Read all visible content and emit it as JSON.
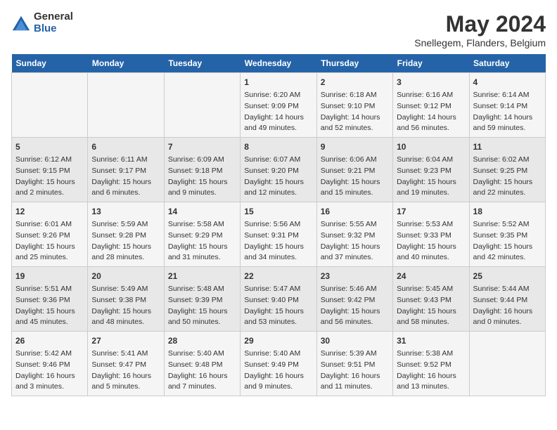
{
  "logo": {
    "general": "General",
    "blue": "Blue"
  },
  "title": "May 2024",
  "subtitle": "Snellegem, Flanders, Belgium",
  "days_header": [
    "Sunday",
    "Monday",
    "Tuesday",
    "Wednesday",
    "Thursday",
    "Friday",
    "Saturday"
  ],
  "weeks": [
    [
      {
        "day": "",
        "info": ""
      },
      {
        "day": "",
        "info": ""
      },
      {
        "day": "",
        "info": ""
      },
      {
        "day": "1",
        "info": "Sunrise: 6:20 AM\nSunset: 9:09 PM\nDaylight: 14 hours and 49 minutes."
      },
      {
        "day": "2",
        "info": "Sunrise: 6:18 AM\nSunset: 9:10 PM\nDaylight: 14 hours and 52 minutes."
      },
      {
        "day": "3",
        "info": "Sunrise: 6:16 AM\nSunset: 9:12 PM\nDaylight: 14 hours and 56 minutes."
      },
      {
        "day": "4",
        "info": "Sunrise: 6:14 AM\nSunset: 9:14 PM\nDaylight: 14 hours and 59 minutes."
      }
    ],
    [
      {
        "day": "5",
        "info": "Sunrise: 6:12 AM\nSunset: 9:15 PM\nDaylight: 15 hours and 2 minutes."
      },
      {
        "day": "6",
        "info": "Sunrise: 6:11 AM\nSunset: 9:17 PM\nDaylight: 15 hours and 6 minutes."
      },
      {
        "day": "7",
        "info": "Sunrise: 6:09 AM\nSunset: 9:18 PM\nDaylight: 15 hours and 9 minutes."
      },
      {
        "day": "8",
        "info": "Sunrise: 6:07 AM\nSunset: 9:20 PM\nDaylight: 15 hours and 12 minutes."
      },
      {
        "day": "9",
        "info": "Sunrise: 6:06 AM\nSunset: 9:21 PM\nDaylight: 15 hours and 15 minutes."
      },
      {
        "day": "10",
        "info": "Sunrise: 6:04 AM\nSunset: 9:23 PM\nDaylight: 15 hours and 19 minutes."
      },
      {
        "day": "11",
        "info": "Sunrise: 6:02 AM\nSunset: 9:25 PM\nDaylight: 15 hours and 22 minutes."
      }
    ],
    [
      {
        "day": "12",
        "info": "Sunrise: 6:01 AM\nSunset: 9:26 PM\nDaylight: 15 hours and 25 minutes."
      },
      {
        "day": "13",
        "info": "Sunrise: 5:59 AM\nSunset: 9:28 PM\nDaylight: 15 hours and 28 minutes."
      },
      {
        "day": "14",
        "info": "Sunrise: 5:58 AM\nSunset: 9:29 PM\nDaylight: 15 hours and 31 minutes."
      },
      {
        "day": "15",
        "info": "Sunrise: 5:56 AM\nSunset: 9:31 PM\nDaylight: 15 hours and 34 minutes."
      },
      {
        "day": "16",
        "info": "Sunrise: 5:55 AM\nSunset: 9:32 PM\nDaylight: 15 hours and 37 minutes."
      },
      {
        "day": "17",
        "info": "Sunrise: 5:53 AM\nSunset: 9:33 PM\nDaylight: 15 hours and 40 minutes."
      },
      {
        "day": "18",
        "info": "Sunrise: 5:52 AM\nSunset: 9:35 PM\nDaylight: 15 hours and 42 minutes."
      }
    ],
    [
      {
        "day": "19",
        "info": "Sunrise: 5:51 AM\nSunset: 9:36 PM\nDaylight: 15 hours and 45 minutes."
      },
      {
        "day": "20",
        "info": "Sunrise: 5:49 AM\nSunset: 9:38 PM\nDaylight: 15 hours and 48 minutes."
      },
      {
        "day": "21",
        "info": "Sunrise: 5:48 AM\nSunset: 9:39 PM\nDaylight: 15 hours and 50 minutes."
      },
      {
        "day": "22",
        "info": "Sunrise: 5:47 AM\nSunset: 9:40 PM\nDaylight: 15 hours and 53 minutes."
      },
      {
        "day": "23",
        "info": "Sunrise: 5:46 AM\nSunset: 9:42 PM\nDaylight: 15 hours and 56 minutes."
      },
      {
        "day": "24",
        "info": "Sunrise: 5:45 AM\nSunset: 9:43 PM\nDaylight: 15 hours and 58 minutes."
      },
      {
        "day": "25",
        "info": "Sunrise: 5:44 AM\nSunset: 9:44 PM\nDaylight: 16 hours and 0 minutes."
      }
    ],
    [
      {
        "day": "26",
        "info": "Sunrise: 5:42 AM\nSunset: 9:46 PM\nDaylight: 16 hours and 3 minutes."
      },
      {
        "day": "27",
        "info": "Sunrise: 5:41 AM\nSunset: 9:47 PM\nDaylight: 16 hours and 5 minutes."
      },
      {
        "day": "28",
        "info": "Sunrise: 5:40 AM\nSunset: 9:48 PM\nDaylight: 16 hours and 7 minutes."
      },
      {
        "day": "29",
        "info": "Sunrise: 5:40 AM\nSunset: 9:49 PM\nDaylight: 16 hours and 9 minutes."
      },
      {
        "day": "30",
        "info": "Sunrise: 5:39 AM\nSunset: 9:51 PM\nDaylight: 16 hours and 11 minutes."
      },
      {
        "day": "31",
        "info": "Sunrise: 5:38 AM\nSunset: 9:52 PM\nDaylight: 16 hours and 13 minutes."
      },
      {
        "day": "",
        "info": ""
      }
    ]
  ]
}
